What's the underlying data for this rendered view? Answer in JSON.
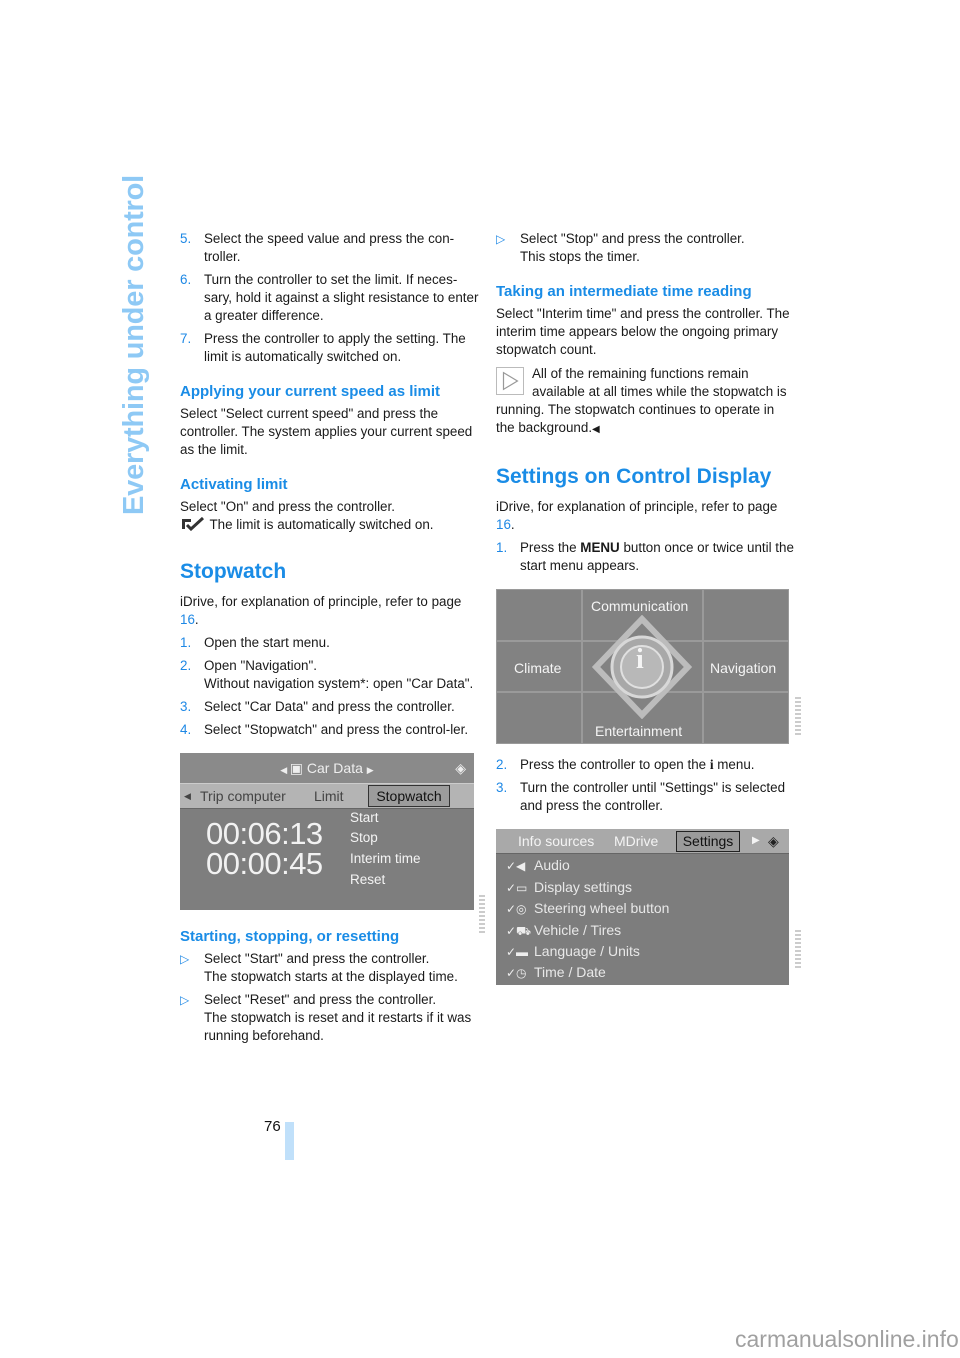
{
  "side_title": "Everything under control",
  "page_number": "76",
  "watermark": "carmanualsonline.info",
  "left": {
    "steps_top": [
      {
        "num": "5.",
        "text": "Select the speed value and press the con-troller."
      },
      {
        "num": "6.",
        "text": "Turn the controller to set the limit. If neces-sary, hold it against a slight resistance to enter a greater difference."
      },
      {
        "num": "7.",
        "text": "Press the controller to apply the setting. The limit is automatically switched on."
      }
    ],
    "h_applying": "Applying your current speed as limit",
    "p_applying": "Select \"Select current speed\" and press the controller. The system applies your current speed as the limit.",
    "h_activating": "Activating limit",
    "p_activating_1": "Select \"On\" and press the controller.",
    "p_activating_2": "The limit is automatically switched on.",
    "h_stopwatch": "Stopwatch",
    "p_idrive_pre": "iDrive, for explanation of principle, refer to page ",
    "p_idrive_link": "16",
    "p_idrive_post": ".",
    "steps_stopwatch": [
      {
        "num": "1.",
        "text": "Open the start menu."
      },
      {
        "num": "2.",
        "text": "Open \"Navigation\".",
        "text2": "Without navigation system*: open \"Car Data\"."
      },
      {
        "num": "3.",
        "text": "Select \"Car Data\" and press the controller."
      },
      {
        "num": "4.",
        "text": "Select \"Stopwatch\" and press the control-ler."
      }
    ],
    "screen": {
      "title": "Car Data",
      "tabs": [
        "Trip computer",
        "Limit",
        "Stopwatch"
      ],
      "selected_tab": "Stopwatch",
      "time_main": "00:06:13",
      "time_interim": "00:00:45",
      "options": [
        "Start",
        "Stop",
        "Interim time",
        "Reset"
      ]
    },
    "h_starting": "Starting, stopping, or resetting",
    "bullets": [
      {
        "text": "Select \"Start\" and press the controller.",
        "text2": "The stopwatch starts at the displayed time."
      },
      {
        "text": "Select \"Reset\" and press the controller.",
        "text2": "The stopwatch is reset and it restarts if it was running beforehand."
      }
    ]
  },
  "right": {
    "bullet_stop": {
      "text": "Select \"Stop\" and press the controller.",
      "text2": "This stops the timer."
    },
    "h_interim": "Taking an intermediate time reading",
    "p_interim": "Select \"Interim time\" and press the controller. The interim time appears below the ongoing primary stopwatch count.",
    "note": "All of the remaining functions remain available at all times while the stopwatch is running. The stopwatch continues to operate in the background.",
    "note_end": "◀",
    "h_settings": "Settings on Control Display",
    "p_idrive_pre": "iDrive, for explanation of principle, refer to page ",
    "p_idrive_link": "16",
    "p_idrive_post": ".",
    "step1_num": "1.",
    "step1_pre": "Press the ",
    "step1_bold": "MENU",
    "step1_post": " button once or twice until the start menu appears.",
    "start_menu": {
      "top": "Communication",
      "left": "Climate",
      "right": "Navigation",
      "bottom": "Entertainment",
      "center_icon": "i"
    },
    "step2_num": "2.",
    "step2_pre": "Press the controller to open the ",
    "step2_icon": "i",
    "step2_post": " menu.",
    "step3_num": "3.",
    "step3_text": "Turn the controller until \"Settings\" is selected and press the controller.",
    "settings_screen": {
      "tabs": [
        "Info sources",
        "MDrive",
        "Settings"
      ],
      "selected_tab": "Settings",
      "items": [
        {
          "icon": "audio-icon",
          "label": "Audio"
        },
        {
          "icon": "display-icon",
          "label": "Display settings"
        },
        {
          "icon": "steering-wheel-icon",
          "label": "Steering wheel button"
        },
        {
          "icon": "vehicle-icon",
          "label": "Vehicle / Tires"
        },
        {
          "icon": "language-icon",
          "label": "Language / Units"
        },
        {
          "icon": "clock-icon",
          "label": "Time / Date"
        }
      ]
    }
  }
}
